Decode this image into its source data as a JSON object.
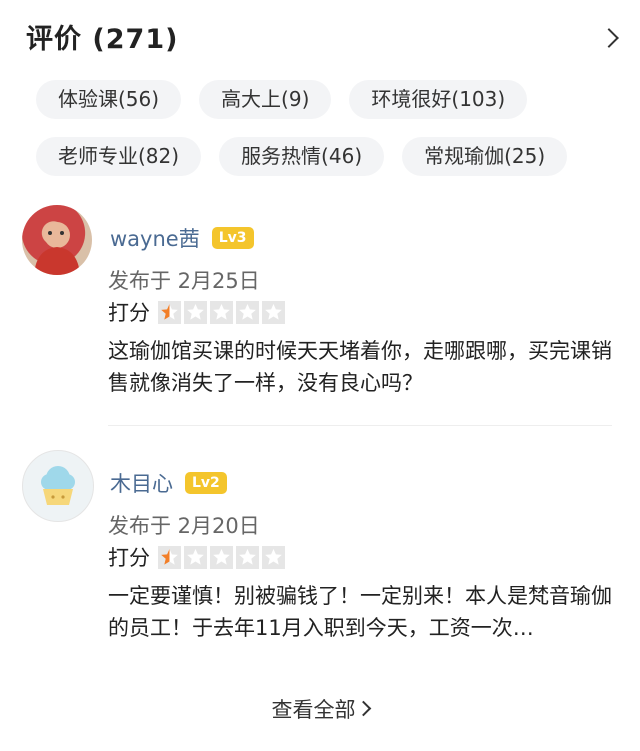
{
  "header": {
    "title": "评价 (271)"
  },
  "tags": [
    [
      "体验课(56)",
      "高大上(9)",
      "环境很好(103)"
    ],
    [
      "老师专业(82)",
      "服务热情(46)",
      "常规瑜伽(25)"
    ]
  ],
  "tag_labels": {
    "t0": "体验课(56)",
    "t1": "高大上(9)",
    "t2": "环境很好(103)",
    "t3": "老师专业(82)",
    "t4": "服务热情(46)",
    "t5": "常规瑜伽(25)"
  },
  "reviews": [
    {
      "username": "wayne茜",
      "level": "Lv3",
      "date": "发布于 2月25日",
      "rating_label": "打分",
      "rating": 0.5,
      "text": "这瑜伽馆买课的时候天天堵着你，走哪跟哪，买完课销售就像消失了一样，没有良心吗？"
    },
    {
      "username": "木目心",
      "level": "Lv2",
      "date": "发布于 2月20日",
      "rating_label": "打分",
      "rating": 0.5,
      "text": "一定要谨慎！别被骗钱了！一定别来！本人是梵音瑜伽的员工！于去年11月入职到今天，工资一次…"
    }
  ],
  "footer": {
    "see_all": "查看全部"
  },
  "colors": {
    "star_active": "#f27e27",
    "star_inactive": "#e6e6e6",
    "level_badge": "#f4c52c",
    "username": "#4a6a92"
  }
}
